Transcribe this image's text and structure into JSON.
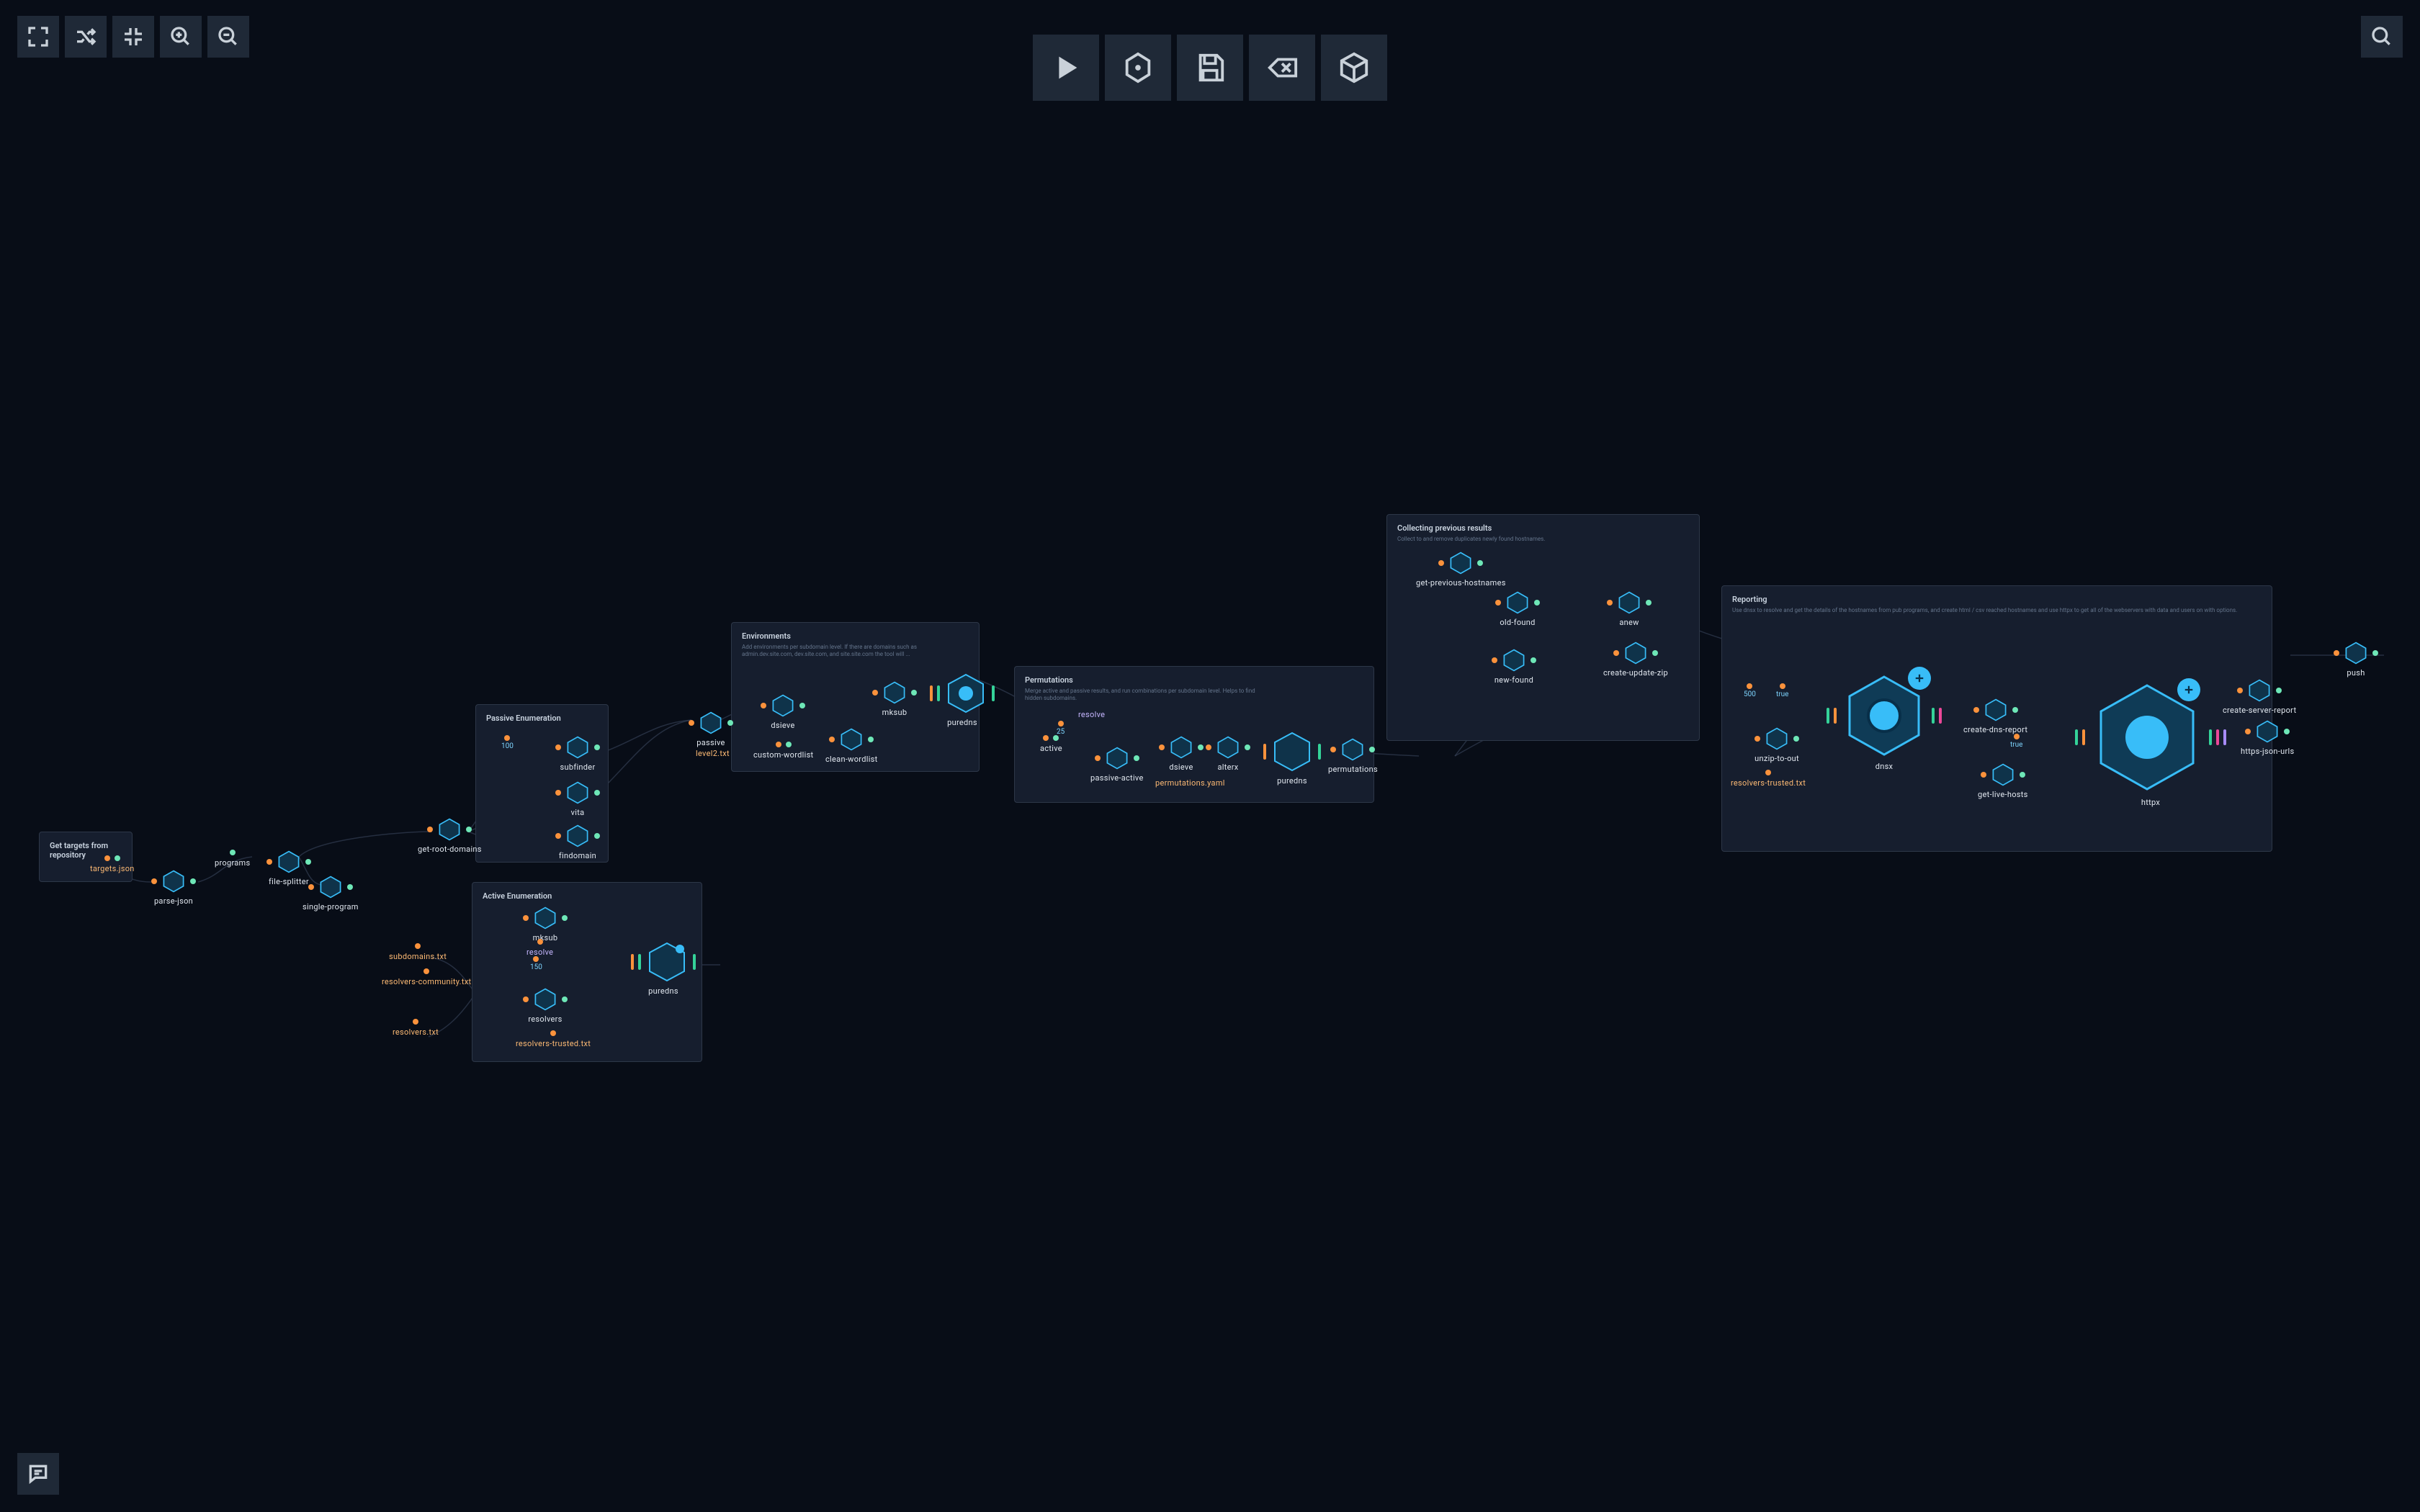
{
  "toolbar_left": {
    "fit": "fit-view",
    "shuffle": "layout-shuffle",
    "collapse": "collapse-all",
    "zoom_in": "zoom-in",
    "zoom_out": "zoom-out"
  },
  "toolbar_top": {
    "run": "run-workflow",
    "engine": "engine-config",
    "save": "save",
    "delete": "clear",
    "package": "package-workflow"
  },
  "toolbar_right": {
    "search": "search"
  },
  "toolbar_bottom": {
    "comments": "comments"
  },
  "groups": {
    "get_targets": {
      "title": "Get targets from repository",
      "nodes": {
        "targets_json": "targets.json"
      }
    },
    "passive_enum": {
      "title": "Passive Enumeration",
      "nodes": {
        "subfinder": "subfinder",
        "value_100": "100",
        "vita": "vita",
        "get_root_domains": "get-root-domains",
        "findomain": "findomain"
      }
    },
    "active_enum": {
      "title": "Active Enumeration",
      "nodes": {
        "mksub": "mksub",
        "resolve": "resolve",
        "value_150": "150",
        "resolvers": "resolvers",
        "resolvers_trusted": "resolvers-trusted.txt",
        "puredns": "puredns"
      }
    },
    "environments": {
      "title": "Environments",
      "desc": "Add environments per subdomain level. If there are domains such as admin.dev.site.com, dev.site.com, and site.site.com the tool will ...",
      "nodes": {
        "passive": "passive",
        "level2": "level2.txt",
        "custom_wordlist": "custom-wordlist",
        "dsieve": "dsieve",
        "clean_wordlist": "clean-wordlist",
        "mksub": "mksub",
        "puredns": "puredns"
      }
    },
    "permutations": {
      "title": "Permutations",
      "desc": "Merge active and passive results, and run combinations per subdomain level. Helps to find hidden subdomains.",
      "nodes": {
        "active": "active",
        "passive_active": "passive-active",
        "value_25": "25",
        "resolve": "resolve",
        "dsieve": "dsieve",
        "alterx": "alterx",
        "puredns": "puredns",
        "permutations": "permutations",
        "permutations_yaml": "permutations.yaml"
      }
    },
    "collecting": {
      "title": "Collecting previous results",
      "desc": "Collect to and remove duplicates newly found hostnames.",
      "nodes": {
        "get_previous_hostnames": "get-previous-hostnames",
        "anew": "anew",
        "old_found": "old-found",
        "new_found": "new-found",
        "create_update_zip": "create-update-zip"
      }
    },
    "reporting": {
      "title": "Reporting",
      "desc": "Use dnsx to resolve and get the details of the hostnames from pub programs, and create html / csv reached hostnames and use httpx to get all of the webservers with data and users on with options.",
      "nodes": {
        "value_500": "500",
        "value_true": "true",
        "unzip_to_out": "unzip-to-out",
        "resolvers_trusted": "resolvers-trusted.txt",
        "dnsx": "dnsx",
        "create_dns_report": "create-dns-report",
        "value_true2": "true",
        "get_live_hosts": "get-live-hosts",
        "httpx": "httpx",
        "create_server_report": "create-server-report",
        "https_json_urls": "https-json-urls",
        "push": "push"
      }
    }
  },
  "loose_nodes": {
    "parse_json": "parse-json",
    "programs": "programs",
    "file_splitter": "file-splitter",
    "single_program": "single-program",
    "subdomains_txt": "subdomains.txt",
    "resolvers_community_txt": "resolvers-community.txt",
    "resolvers_txt": "resolvers.txt"
  }
}
